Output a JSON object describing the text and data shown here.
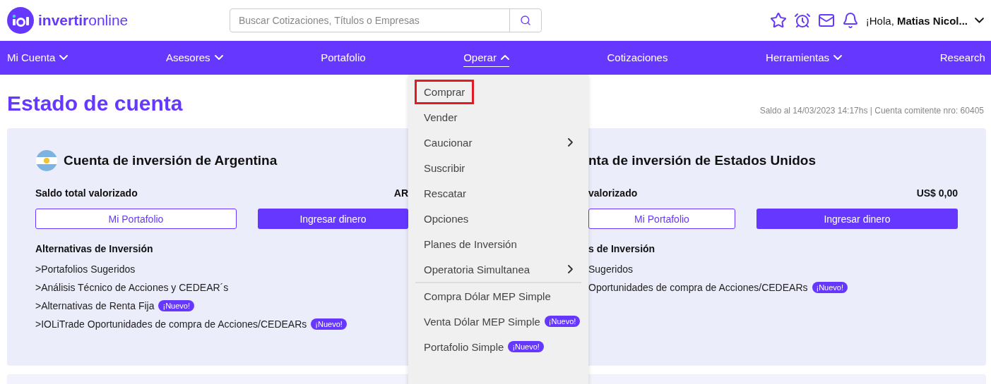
{
  "header": {
    "logo_text": {
      "bold": "invertir",
      "light": "online"
    },
    "search": {
      "placeholder": "Buscar Cotizaciones, Títulos o Empresas"
    },
    "greeting": "¡Hola,",
    "user_name": "Matias Nicol..."
  },
  "nav": [
    {
      "label": "Mi Cuenta",
      "dropdown": true,
      "selected": false
    },
    {
      "label": "Asesores",
      "dropdown": true,
      "selected": false
    },
    {
      "label": "Portafolio",
      "dropdown": false,
      "selected": false
    },
    {
      "label": "Operar",
      "dropdown": true,
      "selected": true
    },
    {
      "label": "Cotizaciones",
      "dropdown": false,
      "selected": false
    },
    {
      "label": "Herramientas",
      "dropdown": true,
      "selected": false
    },
    {
      "label": "Research",
      "dropdown": false,
      "selected": false
    }
  ],
  "page_title": "Estado de cuenta",
  "account_info": "Saldo al 14/03/2023 14:17hs | Cuenta comitente nro: 60405",
  "accounts": [
    {
      "title": "Cuenta de inversión de Argentina",
      "flag": true,
      "balance_label": "Saldo total valorizado",
      "balance": "AR",
      "portfolio_button": "Mi Portafolio",
      "deposit_button": "Ingresar dinero",
      "alternatives_title": "Alternativas de Inversión",
      "links": [
        {
          "text": ">Portafolios Sugeridos"
        },
        {
          "text": ">Análisis Técnico de Acciones y CEDEAR´s"
        },
        {
          "text": ">Alternativas de Renta Fija",
          "badge": "¡Nuevo!"
        },
        {
          "text": ">IOLiTrade Oportunidades de compra de Acciones/CEDEARs",
          "badge": "¡Nuevo!"
        }
      ]
    },
    {
      "title": "nta de inversión de Estados Unidos",
      "flag": false,
      "balance_label": "valorizado",
      "balance": "US$ 0,00",
      "portfolio_button": "Mi Portafolio",
      "deposit_button": "Ingresar dinero",
      "alternatives_title": "s de Inversión",
      "links": [
        {
          "text": "Sugeridos"
        },
        {
          "text": "Oportunidades de compra de Acciones/CEDEARs",
          "badge": "¡Nuevo!"
        }
      ]
    }
  ],
  "operar_menu": [
    {
      "kind": "item",
      "label": "Comprar",
      "outlined": true
    },
    {
      "kind": "item",
      "label": "Vender",
      "outlined": false
    },
    {
      "kind": "submenu",
      "label": "Caucionar",
      "outlined": false
    },
    {
      "kind": "item",
      "label": "Suscribir",
      "outlined": false
    },
    {
      "kind": "item",
      "label": "Rescatar",
      "outlined": false
    },
    {
      "kind": "item",
      "label": "Opciones",
      "outlined": false
    },
    {
      "kind": "item",
      "label": "Planes de Inversión",
      "outlined": false
    },
    {
      "kind": "submenu",
      "label": "Operatoria Simultanea",
      "outlined": false
    },
    {
      "kind": "divider"
    },
    {
      "kind": "item",
      "label": "Compra Dólar MEP Simple",
      "outlined": false
    },
    {
      "kind": "item",
      "label": "Venta Dólar MEP Simple",
      "badge": "¡Nuevo!",
      "outlined": false
    },
    {
      "kind": "item",
      "label": "Portafolio Simple",
      "badge": "¡Nuevo!",
      "outlined": false
    }
  ]
}
